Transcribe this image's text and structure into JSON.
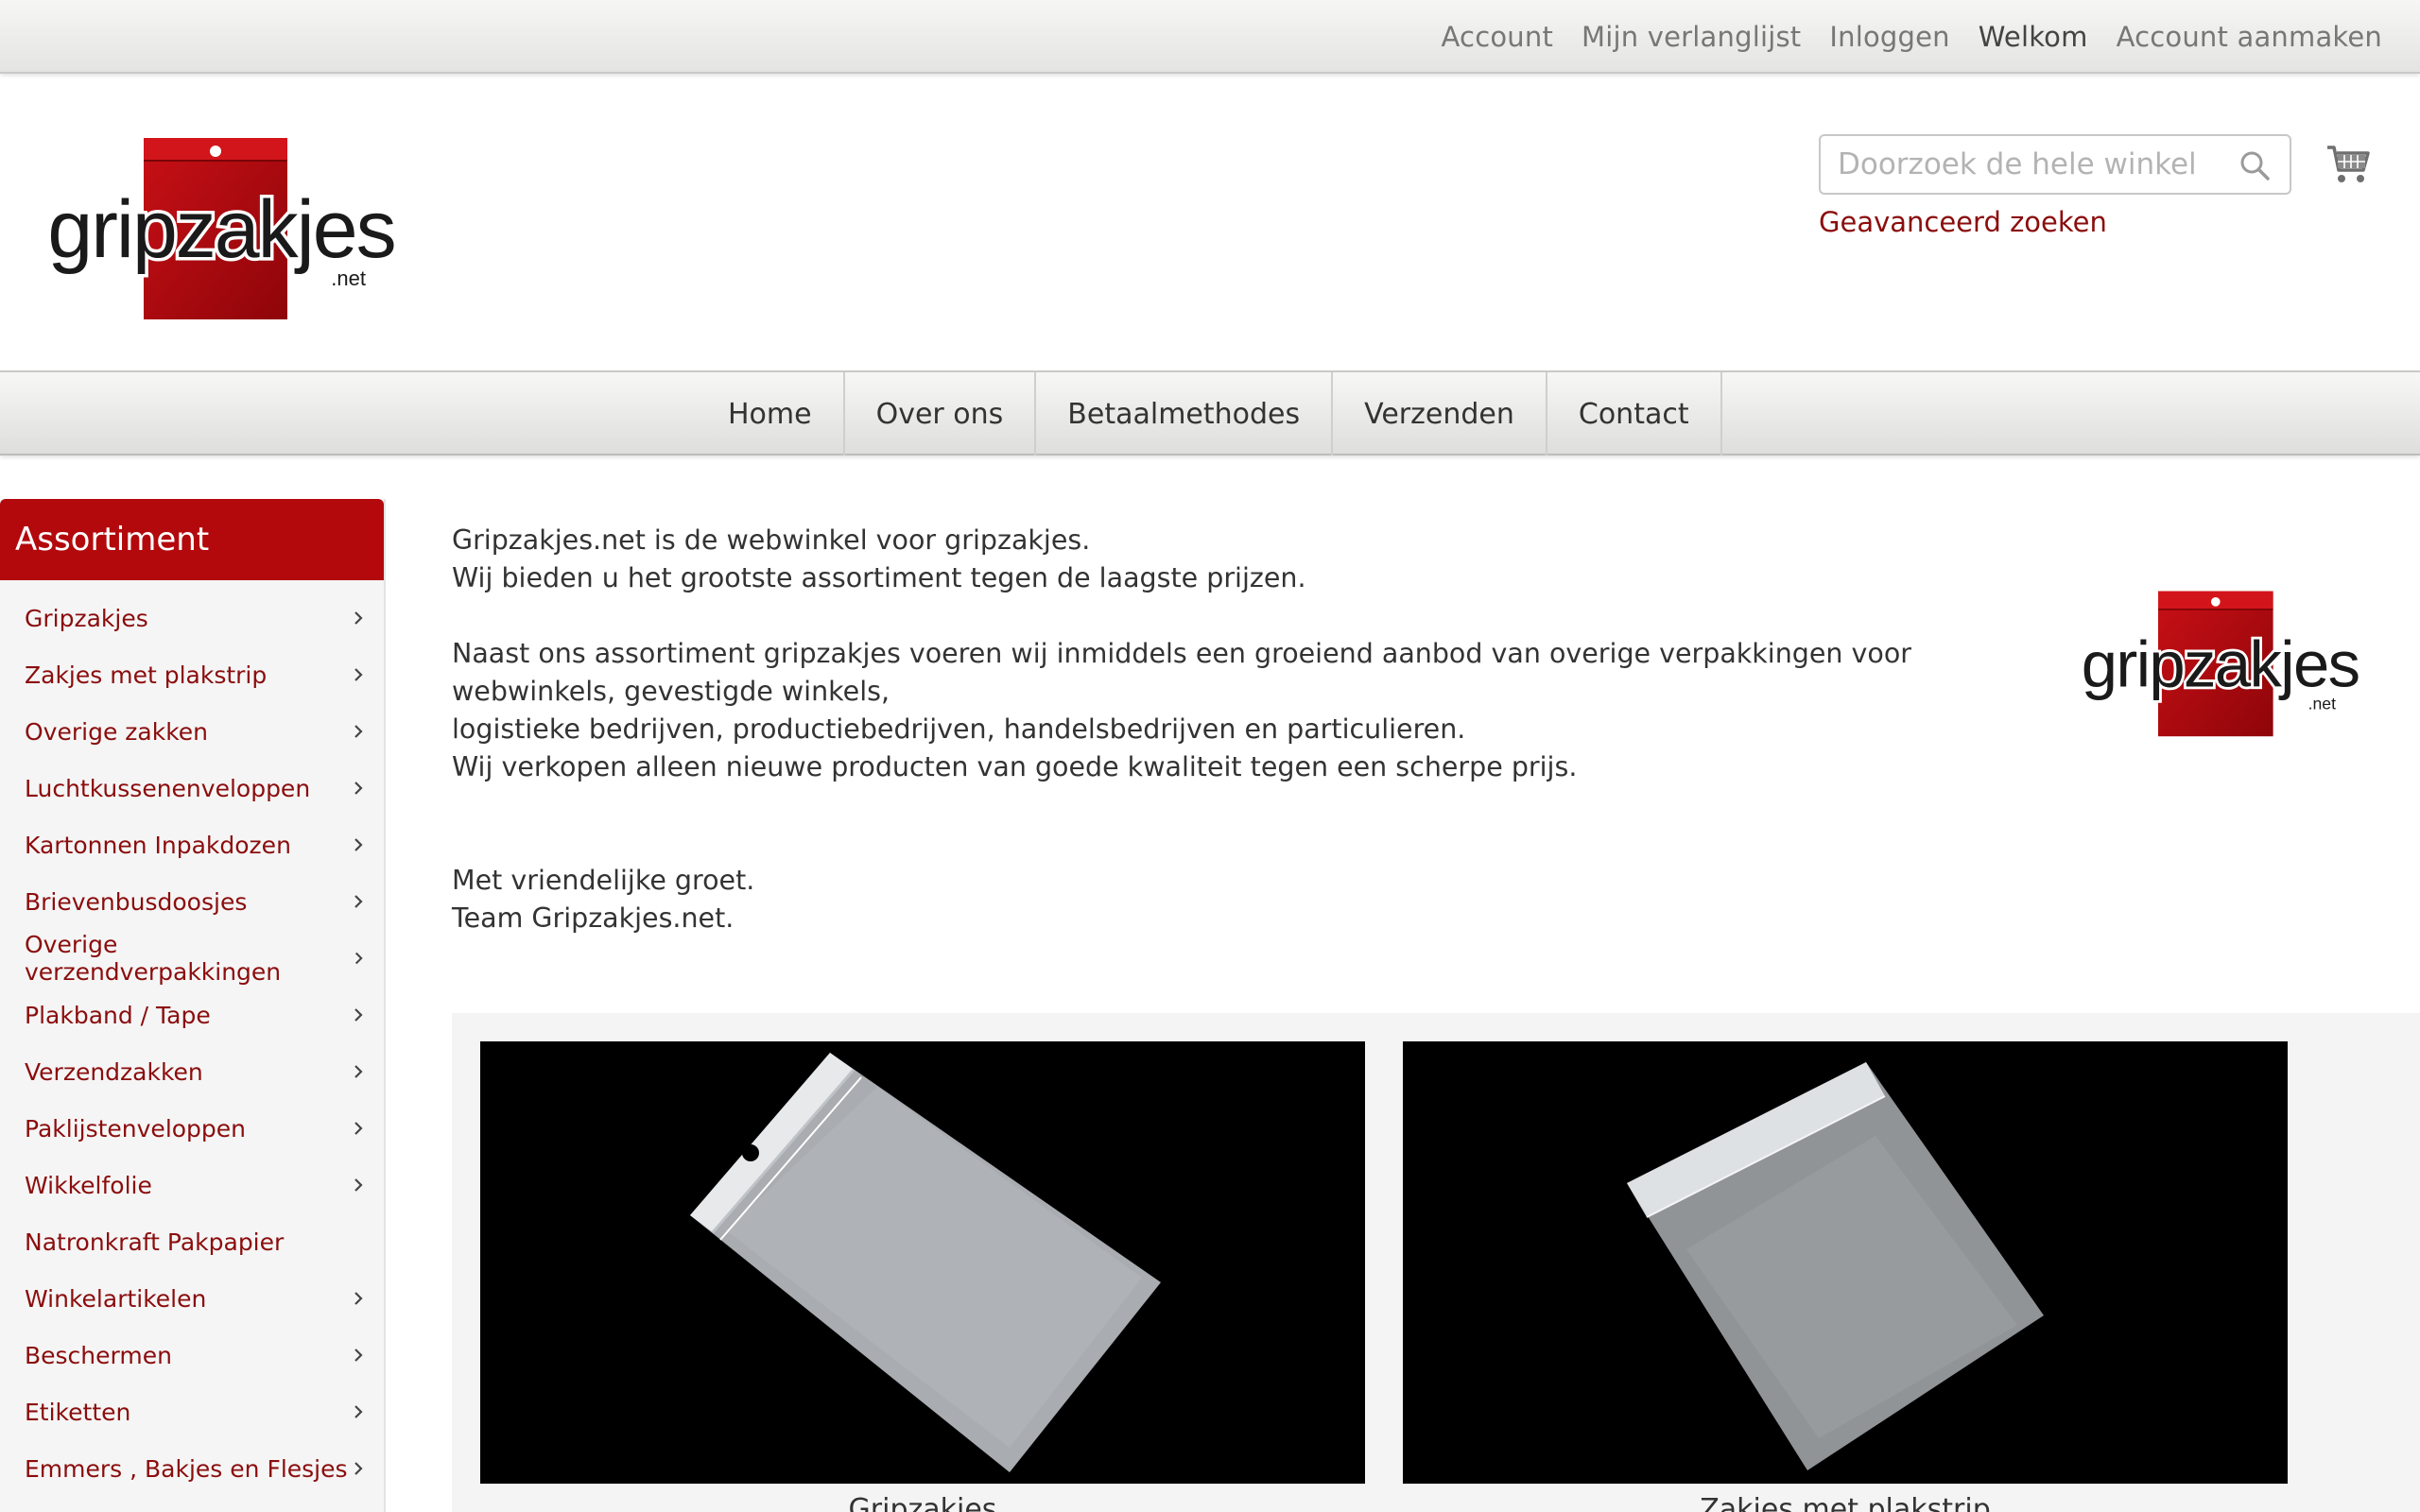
{
  "toplinks": [
    "Account",
    "Mijn verlanglijst",
    "Inloggen",
    "Welkom",
    "Account aanmaken"
  ],
  "brand": {
    "logo_text": "gripzakjes",
    "logo_suffix": ".net",
    "accent": "#b3090d",
    "link_color": "#8b0d0d"
  },
  "search": {
    "placeholder": "Doorzoek de hele winkel",
    "advanced_label": "Geavanceerd zoeken",
    "icon": "search-icon"
  },
  "cart": {
    "icon": "cart-icon"
  },
  "nav": [
    "Home",
    "Over ons",
    "Betaalmethodes",
    "Verzenden",
    "Contact"
  ],
  "sidebar": {
    "title": "Assortiment",
    "items": [
      {
        "label": "Gripzakjes",
        "has_children": true
      },
      {
        "label": "Zakjes met plakstrip",
        "has_children": true
      },
      {
        "label": "Overige zakken",
        "has_children": true
      },
      {
        "label": "Luchtkussenenveloppen",
        "has_children": true
      },
      {
        "label": "Kartonnen Inpakdozen",
        "has_children": true
      },
      {
        "label": "Brievenbusdoosjes",
        "has_children": true
      },
      {
        "label": "Overige verzendverpakkingen",
        "has_children": true
      },
      {
        "label": "Plakband / Tape",
        "has_children": true
      },
      {
        "label": "Verzendzakken",
        "has_children": true
      },
      {
        "label": "Paklijstenveloppen",
        "has_children": true
      },
      {
        "label": "Wikkelfolie",
        "has_children": true
      },
      {
        "label": "Natronkraft Pakpapier",
        "has_children": false
      },
      {
        "label": "Winkelartikelen",
        "has_children": true
      },
      {
        "label": "Beschermen",
        "has_children": true
      },
      {
        "label": "Etiketten",
        "has_children": true
      },
      {
        "label": "Emmers , Bakjes en Flesjes",
        "has_children": true
      }
    ]
  },
  "intro": {
    "p1": "Gripzakjes.net is de webwinkel voor gripzakjes.\nWij bieden u het grootste assortiment tegen de laagste prijzen.",
    "p2": "Naast ons assortiment gripzakjes voeren wij inmiddels een groeiend aanbod van overige verpakkingen voor webwinkels, gevestigde winkels,\nlogistieke bedrijven, productiebedrijven, handelsbedrijven en particulieren.\nWij verkopen alleen nieuwe producten van goede kwaliteit tegen een scherpe prijs.",
    "p3": "Met vriendelijke groet.\nTeam Gripzakjes.net."
  },
  "categories": [
    {
      "caption": "Gripzakjes"
    },
    {
      "caption": "Zakjes met plakstrip"
    }
  ]
}
